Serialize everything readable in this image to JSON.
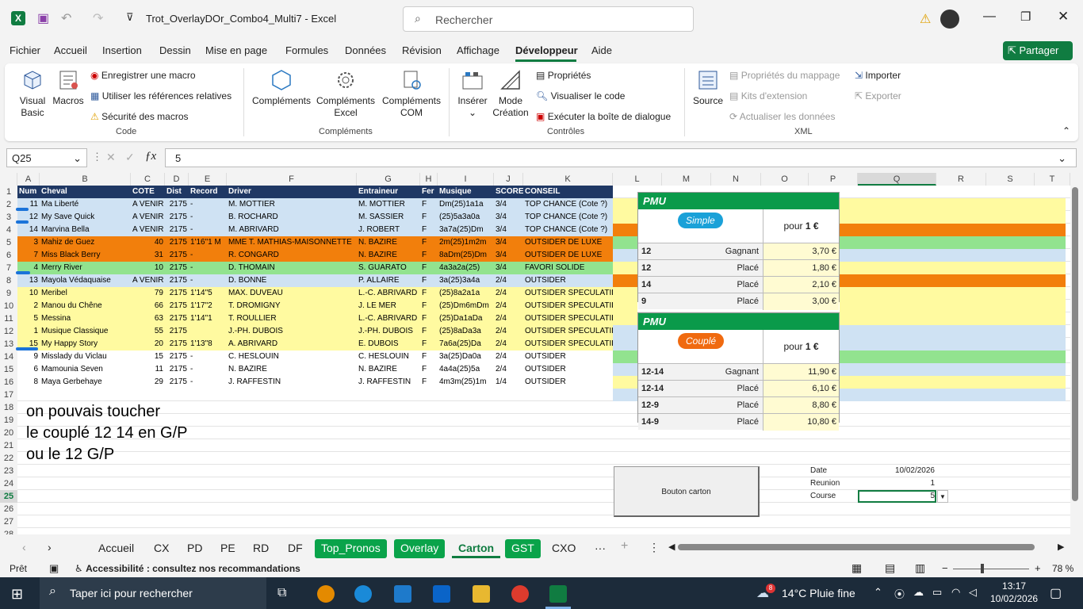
{
  "title": {
    "filename": "Trot_OverlayDOr_Combo4_Multi7",
    "sep": "-",
    "app": "Excel",
    "search_placeholder": "Rechercher"
  },
  "menu": [
    "Fichier",
    "Accueil",
    "Insertion",
    "Dessin",
    "Mise en page",
    "Formules",
    "Données",
    "Révision",
    "Affichage",
    "Développeur",
    "Aide"
  ],
  "share": "Partager",
  "ribbon": {
    "visual_basic": "Visual Basic",
    "macros": "Macros",
    "record": "Enregistrer une macro",
    "relative": "Utiliser les références relatives",
    "security": "Sécurité des macros",
    "grp_code": "Code",
    "complements": "Compléments",
    "complements_excel": "Compléments Excel",
    "complements_com": "Compléments COM",
    "grp_complements": "Compléments",
    "inserer": "Insérer",
    "mode": "Mode Création",
    "proprietes": "Propriétés",
    "visualiser": "Visualiser le code",
    "executer": "Exécuter la boîte de dialogue",
    "grp_controles": "Contrôles",
    "source": "Source",
    "prop_mappage": "Propriétés du mappage",
    "kits": "Kits d'extension",
    "actualiser": "Actualiser les données",
    "importer": "Importer",
    "exporter": "Exporter",
    "grp_xml": "XML"
  },
  "formula": {
    "namebox": "Q25",
    "value": "5"
  },
  "columns": [
    "A",
    "B",
    "C",
    "D",
    "E",
    "F",
    "G",
    "H",
    "I",
    "J",
    "K",
    "L",
    "M",
    "N",
    "O",
    "P",
    "Q",
    "R",
    "S",
    "T"
  ],
  "headers": [
    "Num",
    "Cheval",
    "COTE",
    "Dist",
    "Record",
    "Driver",
    "Entraineur",
    "Fer",
    "Musique",
    "SCORE",
    "CONSEIL"
  ],
  "rows": [
    [
      "11",
      "Ma Liberté",
      "A VENIR",
      "2175",
      "-",
      "M. MOTTIER",
      "M. MOTTIER",
      "F",
      "Dm(25)1a1a",
      "3/4",
      "TOP CHANCE (Cote ?)"
    ],
    [
      "12",
      "My Save Quick",
      "A VENIR",
      "2175",
      "-",
      "B. ROCHARD",
      "M. SASSIER",
      "F",
      "(25)5a3a0a",
      "3/4",
      "TOP CHANCE (Cote ?)"
    ],
    [
      "14",
      "Marvina Bella",
      "A VENIR",
      "2175",
      "-",
      "M. ABRIVARD",
      "J. ROBERT",
      "F",
      "3a7a(25)Dm",
      "3/4",
      "TOP CHANCE (Cote ?)"
    ],
    [
      "3",
      "Mahiz de Guez",
      "40",
      "2175",
      "1'16\"1 M",
      "MME T. MATHIAS-MAISONNETTE",
      "N. BAZIRE",
      "F",
      "2m(25)1m2m",
      "3/4",
      "OUTSIDER DE LUXE"
    ],
    [
      "7",
      "Miss Black Berry",
      "31",
      "2175",
      "-",
      "R. CONGARD",
      "N. BAZIRE",
      "F",
      "8aDm(25)Dm",
      "3/4",
      "OUTSIDER DE LUXE"
    ],
    [
      "4",
      "Merry River",
      "10",
      "2175",
      "-",
      "D. THOMAIN",
      "S. GUARATO",
      "F",
      "4a3a2a(25)",
      "3/4",
      "FAVORI SOLIDE"
    ],
    [
      "13",
      "Mayola Védaquaise",
      "A VENIR",
      "2175",
      "-",
      "D. BONNE",
      "P. ALLAIRE",
      "F",
      "3a(25)3a4a",
      "2/4",
      "OUTSIDER"
    ],
    [
      "10",
      "Meribel",
      "79",
      "2175",
      "1'14\"5",
      "MAX. DUVEAU",
      "L.-C. ABRIVARD",
      "F",
      "(25)8a2a1a",
      "2/4",
      "OUTSIDER SPECULATIF"
    ],
    [
      "2",
      "Manou du Chêne",
      "66",
      "2175",
      "1'17\"2",
      "T. DROMIGNY",
      "J. LE MER",
      "F",
      "(25)Dm6mDm",
      "2/4",
      "OUTSIDER SPECULATIF"
    ],
    [
      "5",
      "Messina",
      "63",
      "2175",
      "1'14\"1",
      "T. ROULLIER",
      "L.-C. ABRIVARD",
      "F",
      "(25)Da1aDa",
      "2/4",
      "OUTSIDER SPECULATIF"
    ],
    [
      "1",
      "Musique Classique",
      "55",
      "2175",
      "",
      "J.-PH. DUBOIS",
      "J.-PH. DUBOIS",
      "F",
      "(25)8aDa3a",
      "2/4",
      "OUTSIDER SPECULATIF"
    ],
    [
      "15",
      "My Happy Story",
      "20",
      "2175",
      "1'13\"8",
      "A. ABRIVARD",
      "E. DUBOIS",
      "F",
      "7a6a(25)Da",
      "2/4",
      "OUTSIDER SPECULATIF"
    ],
    [
      "9",
      "Misslady du Viclau",
      "15",
      "2175",
      "-",
      "C. HESLOUIN",
      "C. HESLOUIN",
      "F",
      "3a(25)Da0a",
      "2/4",
      "OUTSIDER"
    ],
    [
      "6",
      "Mamounia Seven",
      "11",
      "2175",
      "-",
      "N. BAZIRE",
      "N. BAZIRE",
      "F",
      "4a4a(25)5a",
      "2/4",
      "OUTSIDER"
    ],
    [
      "8",
      "Maya Gerbehaye",
      "29",
      "2175",
      "-",
      "J. RAFFESTIN",
      "J. RAFFESTIN",
      "F",
      "4m3m(25)1m",
      "1/4",
      "OUTSIDER"
    ]
  ],
  "note": [
    "on pouvais toucher",
    "le couplé 12 14 en G/P",
    "ou le 12 G/P"
  ],
  "simple": {
    "brand": "PMU",
    "type": "Simple",
    "pour": "pour",
    "mise": "1 €",
    "rows": [
      [
        "12",
        "Gagnant",
        "3,70 €"
      ],
      [
        "12",
        "Placé",
        "1,80 €"
      ],
      [
        "14",
        "Placé",
        "2,10 €"
      ],
      [
        "9",
        "Placé",
        "3,00 €"
      ]
    ]
  },
  "couple": {
    "brand": "PMU",
    "type": "Couplé",
    "pour": "pour",
    "mise": "1 €",
    "rows": [
      [
        "12-14",
        "Gagnant",
        "11,90 €"
      ],
      [
        "12-14",
        "Placé",
        "6,10 €"
      ],
      [
        "12-9",
        "Placé",
        "8,80 €"
      ],
      [
        "14-9",
        "Placé",
        "10,80 €"
      ]
    ]
  },
  "bouton": "Bouton carton",
  "info": {
    "date_label": "Date",
    "date": "10/02/2026",
    "reunion_label": "Reunion",
    "reunion": "1",
    "course_label": "Course",
    "course": "5"
  },
  "sheets": [
    "Accueil",
    "CX",
    "PD",
    "PE",
    "RD",
    "DF",
    "Top_Pronos",
    "Overlay",
    "Carton",
    "GST",
    "CXO"
  ],
  "status": {
    "ready": "Prêt",
    "access": "Accessibilité : consultez nos recommandations",
    "zoom": "78 %"
  },
  "taskbar": {
    "search": "Taper ici pour rechercher",
    "weather": "14°C  Pluie fine",
    "time": "13:17",
    "date": "10/02/2026",
    "badge": "8"
  },
  "colors": {
    "blue": "#cfe2f3",
    "orange": "#f27f0c",
    "green": "#92e38f",
    "yellow": "#fffaa0",
    "header": "#1f3864",
    "excel_green": "#107c41"
  }
}
